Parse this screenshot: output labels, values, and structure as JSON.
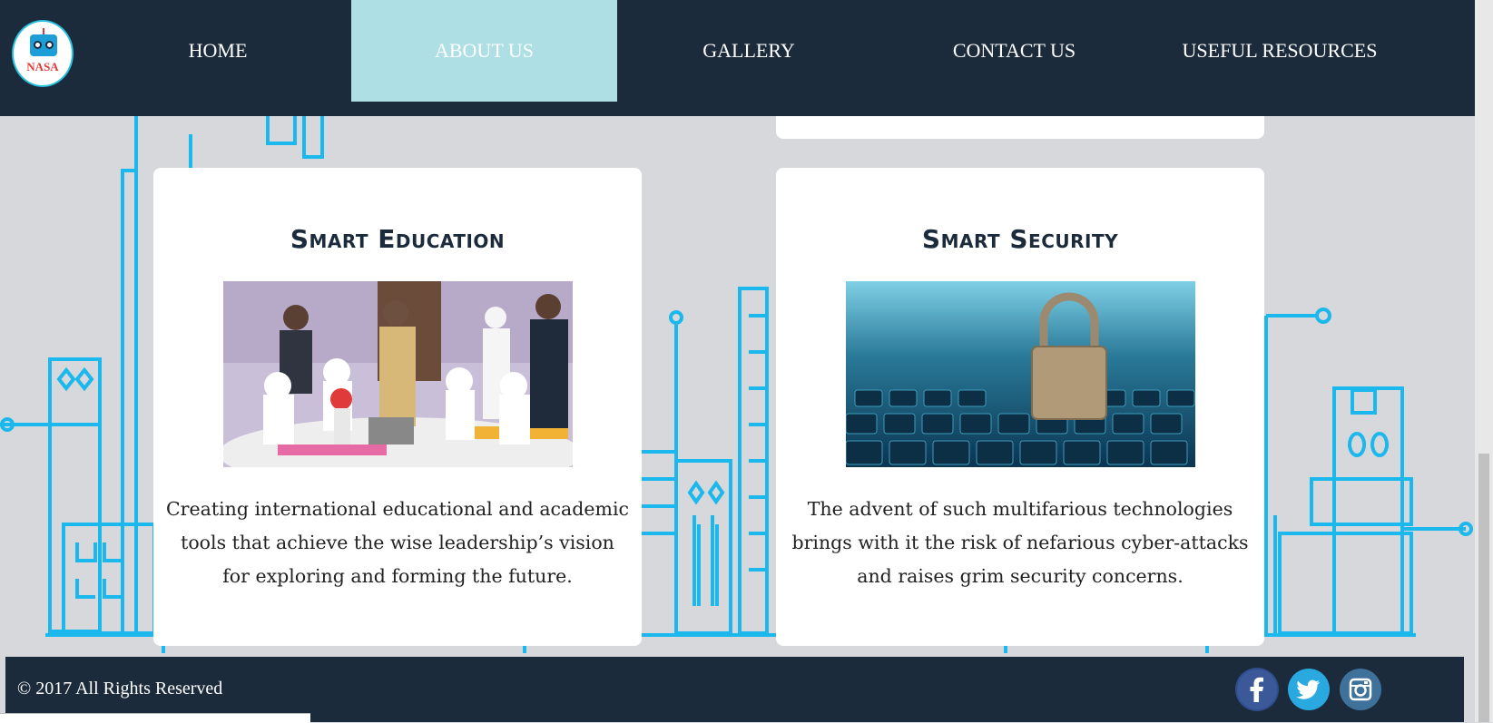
{
  "logo": {
    "text": "NASA"
  },
  "nav": {
    "items": [
      {
        "label": "HOME"
      },
      {
        "label": "ABOUT US"
      },
      {
        "label": "GALLERY"
      },
      {
        "label": "CONTACT US"
      },
      {
        "label": "USEFUL RESOURCES"
      }
    ],
    "active_index": 1
  },
  "cards": [
    {
      "title": "Smart Education",
      "text": "Creating international educational and academic tools that achieve the wise leadership’s vision for exploring and forming the future.",
      "image": "classroom-robot-photo"
    },
    {
      "title": "Smart Security",
      "text": "The advent of such multifarious technologies brings with it the risk of nefarious cyber-attacks and raises grim security concerns.",
      "image": "padlock-keyboard-photo"
    }
  ],
  "footer": {
    "copyright": "© 2017 All Rights Reserved",
    "social": [
      {
        "icon": "facebook-icon",
        "glyph": "f",
        "color": "#3b5998"
      },
      {
        "icon": "twitter-icon",
        "glyph": "t",
        "color": "#2aa9e0"
      },
      {
        "icon": "instagram-icon",
        "glyph": "i",
        "color": "#3f729b"
      }
    ]
  },
  "colors": {
    "navbar": "#1c2b3c",
    "active_tab": "#aedfe5",
    "city_lines": "#1ab8ec",
    "background": "#d7d8dc"
  }
}
